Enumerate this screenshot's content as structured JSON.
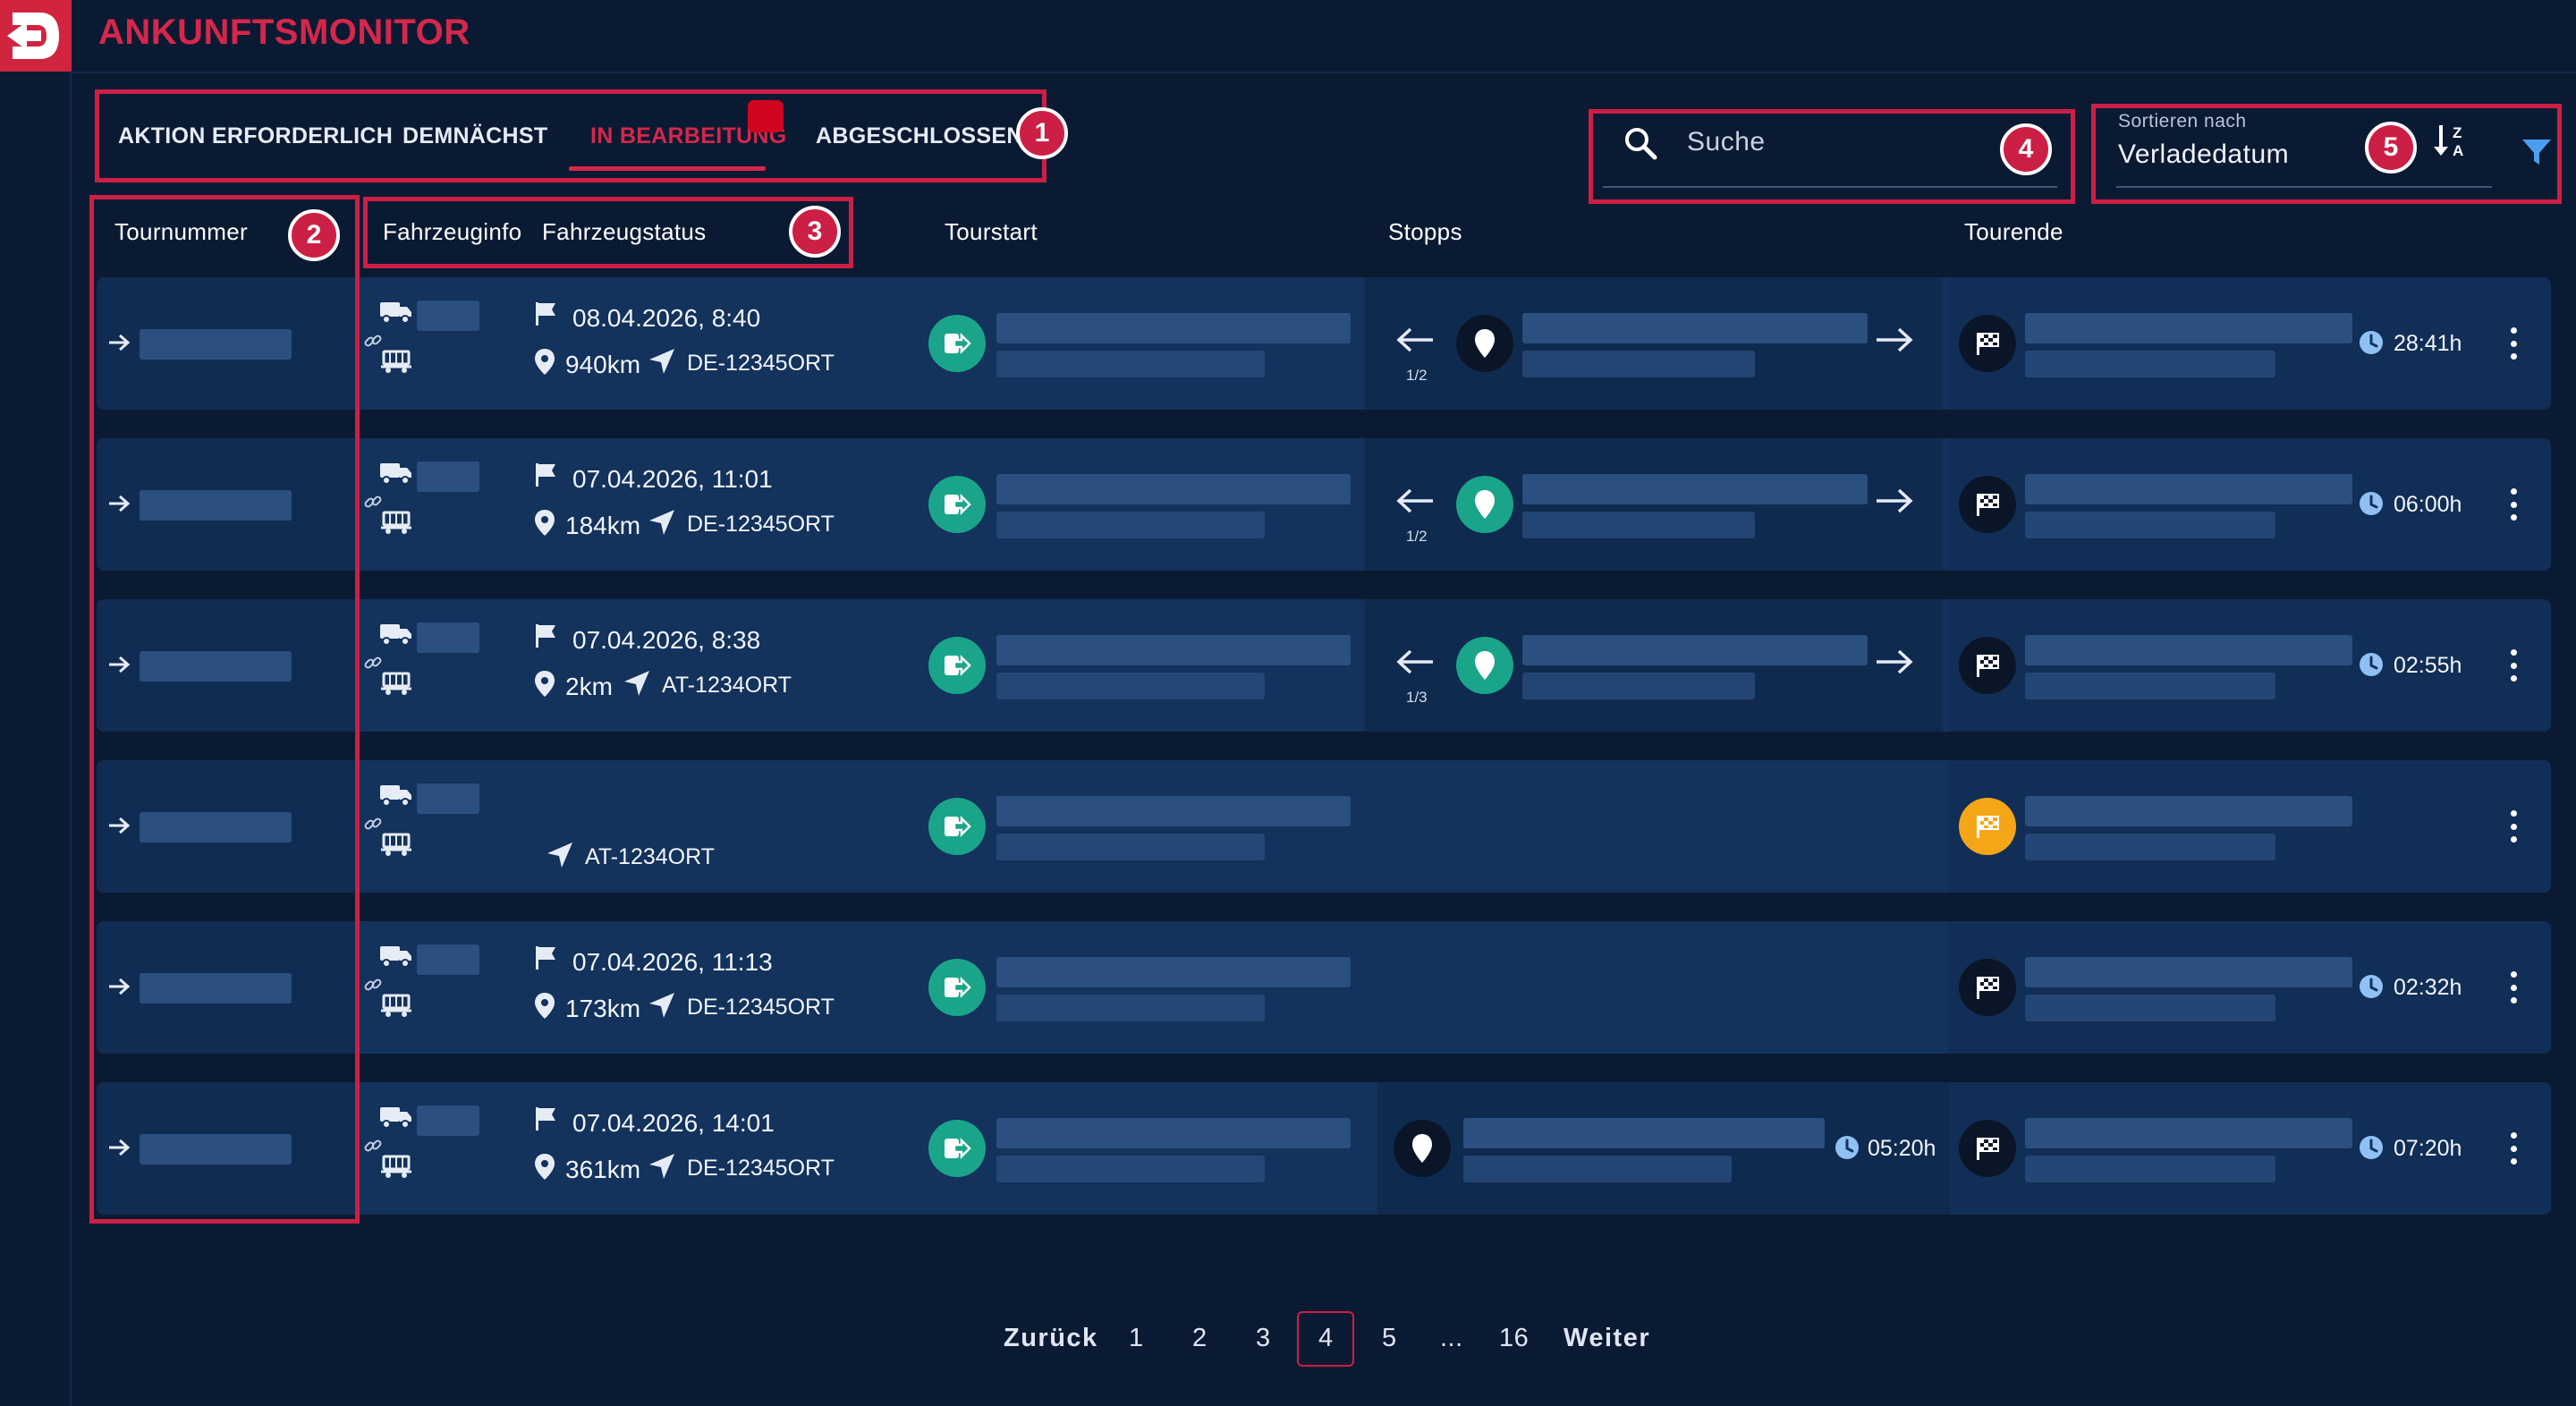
{
  "app": {
    "title": "ANKUNFTSMONITOR"
  },
  "tabs": [
    {
      "label": "AKTION ERFORDERLICH"
    },
    {
      "label": "DEMNÄCHST"
    },
    {
      "label": "IN BEARBEITUNG",
      "active": true
    },
    {
      "label": "ABGESCHLOSSENE"
    }
  ],
  "search": {
    "placeholder": "Suche"
  },
  "sort": {
    "label": "Sortieren nach",
    "value": "Verladedatum"
  },
  "columns": {
    "tournummer": "Tournummer",
    "fahrzeuginfo": "Fahrzeuginfo",
    "fahrzeugstatus": "Fahrzeugstatus",
    "tourstart": "Tourstart",
    "stopps": "Stopps",
    "tourende": "Tourende"
  },
  "annotations": [
    "1",
    "2",
    "3",
    "4",
    "5"
  ],
  "rows": [
    {
      "date": "08.04.2026, 8:40",
      "distance": "940km",
      "location": "DE-12345ORT",
      "stop_index": "1/2",
      "stop_pin": "dark",
      "end_flag": "dark",
      "duration": "28:41h"
    },
    {
      "date": "07.04.2026, 11:01",
      "distance": "184km",
      "location": "DE-12345ORT",
      "stop_index": "1/2",
      "stop_pin": "green",
      "end_flag": "dark",
      "duration": "06:00h"
    },
    {
      "date": "07.04.2026, 8:38",
      "distance": "2km",
      "location": "AT-1234ORT",
      "stop_index": "1/3",
      "stop_pin": "green",
      "end_flag": "dark",
      "duration": "02:55h"
    },
    {
      "date": "",
      "distance": "",
      "location": "AT-1234ORT",
      "stop_index": "",
      "end_flag": "amber",
      "duration": ""
    },
    {
      "date": "07.04.2026, 11:13",
      "distance": "173km",
      "location": "DE-12345ORT",
      "stop_index": "",
      "end_flag": "dark",
      "duration": "02:32h"
    },
    {
      "date": "07.04.2026, 14:01",
      "distance": "361km",
      "location": "DE-12345ORT",
      "stop_index": "",
      "stop_pin": "dark",
      "stop_duration": "05:20h",
      "end_flag": "dark",
      "duration": "07:20h"
    }
  ],
  "pagination": {
    "prev": "Zurück",
    "next": "Weiter",
    "pages": [
      "1",
      "2",
      "3",
      "4",
      "5",
      "...",
      "16"
    ],
    "current": "4"
  },
  "colors": {
    "accent": "#cc1f45",
    "background": "#0b1a33",
    "row": "#13325c",
    "start_green": "#1aa58a",
    "amber": "#f5a616"
  }
}
